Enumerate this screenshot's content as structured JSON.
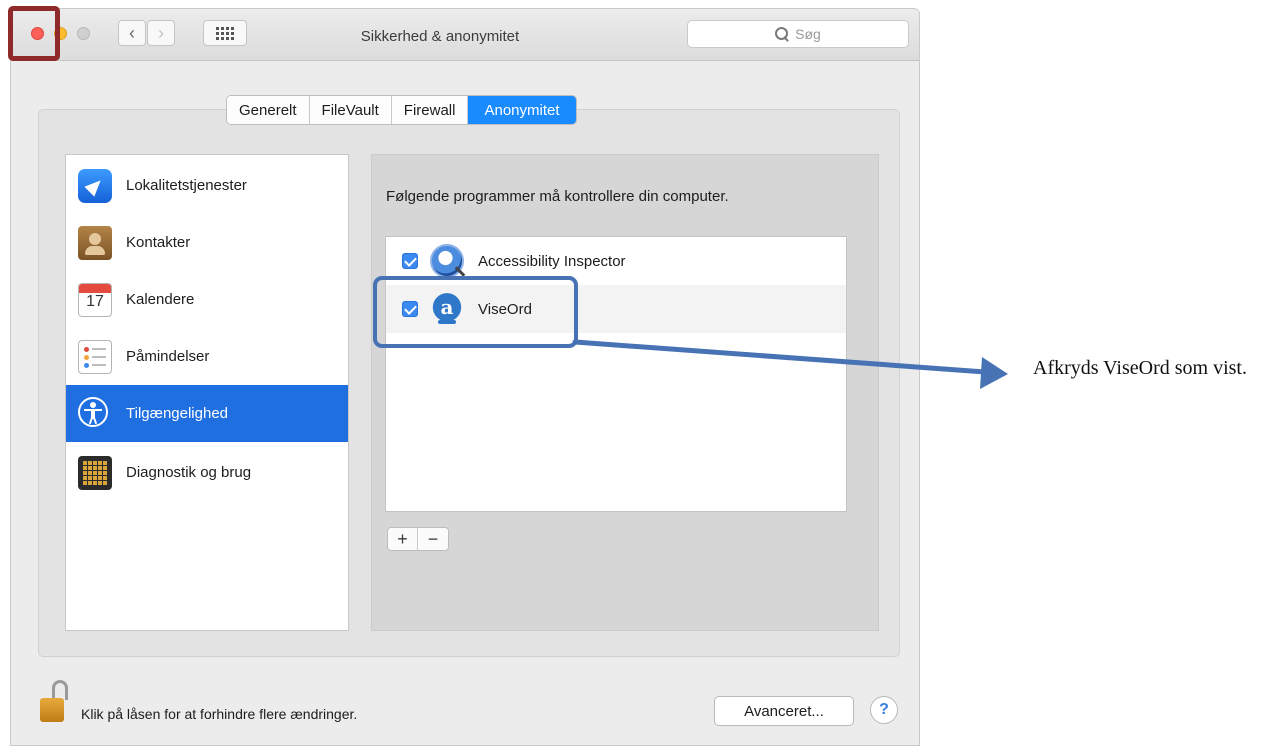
{
  "window": {
    "title": "Sikkerhed & anonymitet"
  },
  "search": {
    "placeholder": "Søg"
  },
  "tabs": [
    {
      "label": "Generelt",
      "active": false
    },
    {
      "label": "FileVault",
      "active": false
    },
    {
      "label": "Firewall",
      "active": false
    },
    {
      "label": "Anonymitet",
      "active": true
    }
  ],
  "sidebar": {
    "items": [
      {
        "label": "Lokalitetstjenester",
        "icon": "location-arrow-icon",
        "selected": false
      },
      {
        "label": "Kontakter",
        "icon": "contacts-book-icon",
        "selected": false
      },
      {
        "label": "Kalendere",
        "icon": "calendar-icon",
        "selected": false,
        "icon_text": "17"
      },
      {
        "label": "Påmindelser",
        "icon": "reminders-list-icon",
        "selected": false
      },
      {
        "label": "Tilgængelighed",
        "icon": "accessibility-icon",
        "selected": true
      },
      {
        "label": "Diagnostik og brug",
        "icon": "diagnostics-grid-icon",
        "selected": false
      }
    ]
  },
  "panel": {
    "description": "Følgende programmer må kontrollere din computer.",
    "apps": [
      {
        "name": "Accessibility Inspector",
        "checked": true,
        "icon": "accessibility-inspector-icon"
      },
      {
        "name": "ViseOrd",
        "checked": true,
        "icon": "viseord-icon"
      }
    ],
    "add_label": "+",
    "remove_label": "−"
  },
  "footer": {
    "lock_text": "Klik på låsen for at forhindre flere ændringer.",
    "advanced_label": "Avanceret...",
    "help_label": "?"
  },
  "annotation": {
    "text": "Afkryds ViseOrd som vist."
  },
  "colors": {
    "accent": "#1a8aff",
    "selection": "#1f6fe0",
    "callout": "#4773b5",
    "close_highlight": "#8e2a2a"
  }
}
